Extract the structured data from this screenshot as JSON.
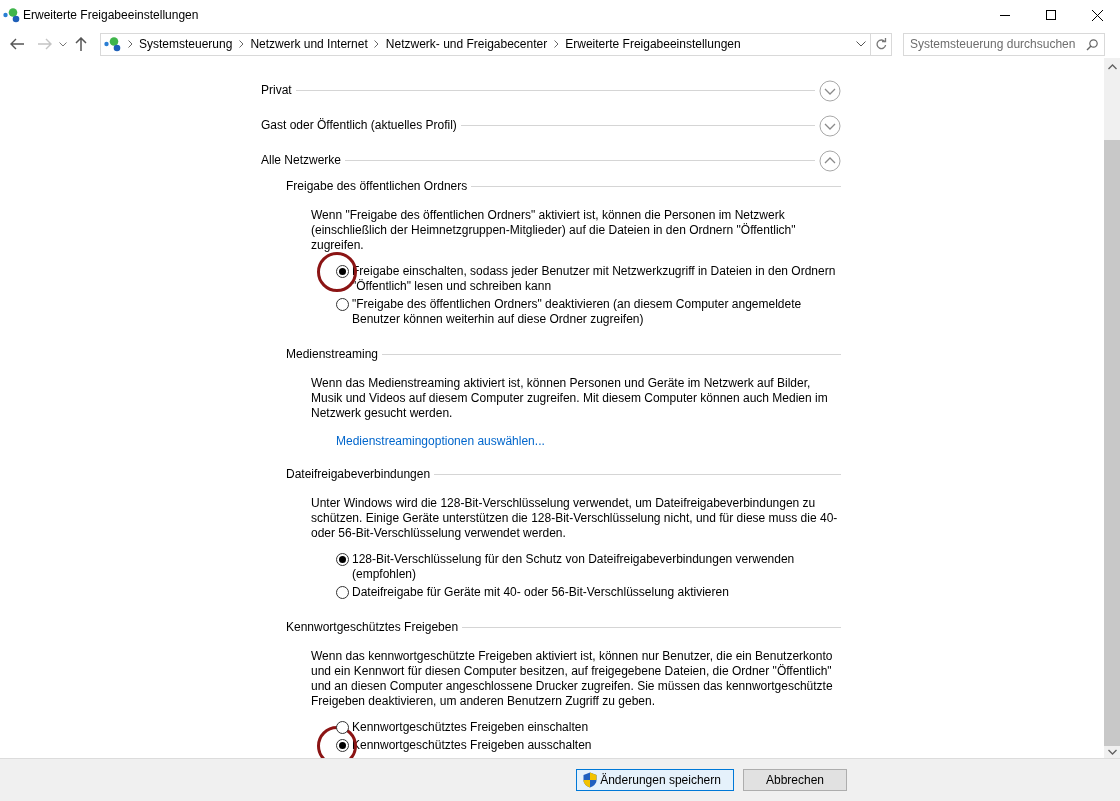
{
  "window": {
    "title": "Erweiterte Freigabeeinstellungen"
  },
  "navigation": {
    "back_disabled": false,
    "forward_disabled": true
  },
  "address_bar": {
    "breadcrumbs": [
      "Systemsteuerung",
      "Netzwerk und Internet",
      "Netzwerk- und Freigabecenter",
      "Erweiterte Freigabeeinstellungen"
    ]
  },
  "search": {
    "placeholder": "Systemsteuerung durchsuchen"
  },
  "content": {
    "profiles": [
      {
        "label": "Privat",
        "expanded": false
      },
      {
        "label": "Gast oder Öffentlich (aktuelles Profil)",
        "expanded": false
      },
      {
        "label": "Alle Netzwerke",
        "expanded": true,
        "sections": [
          {
            "title": "Freigabe des öffentlichen Ordners",
            "description": "Wenn \"Freigabe des öffentlichen Ordners\" aktiviert ist, können die Personen im Netzwerk (einschließlich der Heimnetzgruppen-Mitglieder) auf die Dateien in den Ordnern \"Öffentlich\" zugreifen.",
            "options": [
              {
                "label": "Freigabe einschalten, sodass jeder Benutzer mit Netzwerkzugriff in Dateien in den Ordnern \"Öffentlich\" lesen und schreiben kann",
                "selected": true,
                "circled": true
              },
              {
                "label": "\"Freigabe des öffentlichen Ordners\" deaktivieren (an diesem Computer angemeldete Benutzer können weiterhin auf diese Ordner zugreifen)",
                "selected": false,
                "circled": false
              }
            ]
          },
          {
            "title": "Medienstreaming",
            "description": "Wenn das Medienstreaming aktiviert ist, können Personen und Geräte im Netzwerk auf Bilder, Musik und Videos auf diesem Computer zugreifen. Mit diesem Computer können auch Medien im Netzwerk gesucht werden.",
            "link": "Medienstreamingoptionen auswählen..."
          },
          {
            "title": "Dateifreigabeverbindungen",
            "description": "Unter Windows wird die 128-Bit-Verschlüsselung verwendet, um Dateifreigabeverbindungen zu schützen. Einige Geräte unterstützen die 128-Bit-Verschlüsselung nicht, und für diese muss die 40- oder 56-Bit-Verschlüsselung verwendet werden.",
            "options": [
              {
                "label": "128-Bit-Verschlüsselung für den Schutz von Dateifreigabeverbindungen verwenden (empfohlen)",
                "selected": true,
                "circled": false
              },
              {
                "label": "Dateifreigabe für Geräte mit 40- oder 56-Bit-Verschlüsselung aktivieren",
                "selected": false,
                "circled": false
              }
            ]
          },
          {
            "title": "Kennwortgeschütztes Freigeben",
            "description": "Wenn das kennwortgeschützte Freigeben aktiviert ist, können nur Benutzer, die ein Benutzerkonto und ein Kennwort für diesen Computer besitzen, auf freigegebene Dateien, die Ordner \"Öffentlich\" und an diesen Computer angeschlossene Drucker zugreifen. Sie müssen das kennwortgeschützte Freigeben deaktivieren, um anderen Benutzern Zugriff zu geben.",
            "options": [
              {
                "label": "Kennwortgeschütztes Freigeben einschalten",
                "selected": false,
                "circled": false
              },
              {
                "label": "Kennwortgeschütztes Freigeben ausschalten",
                "selected": true,
                "circled": true
              }
            ]
          }
        ]
      }
    ]
  },
  "buttons": [
    {
      "label": "Änderungen speichern",
      "kind": "uac"
    },
    {
      "label": "Abbrechen",
      "kind": "plain"
    }
  ]
}
